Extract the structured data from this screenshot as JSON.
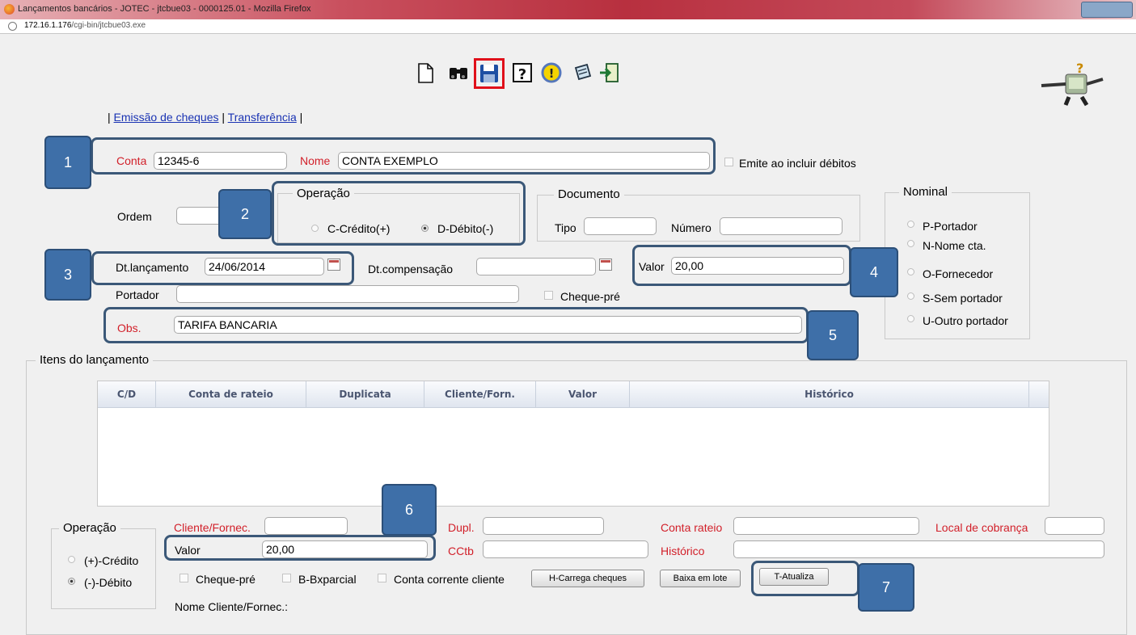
{
  "window": {
    "title": "Lançamentos bancários - JOTEC - jtcbue03 - 0000125.01 - Mozilla Firefox"
  },
  "url": {
    "host": "172.16.1.176",
    "path": "/cgi-bin/jtcbue03.exe"
  },
  "toolbar": {
    "icons": [
      "new-document-icon",
      "binoculars-search-icon",
      "save-floppy-icon",
      "help-question-icon",
      "warning-icon",
      "edit-note-icon",
      "exit-door-icon"
    ]
  },
  "links": {
    "cheques": "Emissão de cheques",
    "transfer": "Transferência",
    "sep": "|"
  },
  "conta": {
    "label": "Conta",
    "value": "12345-6"
  },
  "nome": {
    "label": "Nome",
    "value": "CONTA EXEMPLO"
  },
  "emite": {
    "label": "Emite ao incluir débitos"
  },
  "ordem": {
    "label": "Ordem",
    "value": ""
  },
  "operacao": {
    "title": "Operação",
    "credito": "C-Crédito(+)",
    "debito": "D-Débito(-)",
    "selected": "D"
  },
  "documento": {
    "title": "Documento",
    "tipo_label": "Tipo",
    "numero_label": "Número"
  },
  "nominal": {
    "title": "Nominal",
    "options": [
      "P-Portador",
      "N-Nome cta.",
      "O-Fornecedor",
      "S-Sem portador",
      "U-Outro portador"
    ]
  },
  "dt_lancamento": {
    "label": "Dt.lançamento",
    "value": "24/06/2014"
  },
  "dt_compensacao": {
    "label": "Dt.compensação",
    "value": ""
  },
  "valor": {
    "label": "Valor",
    "value": "20,00"
  },
  "portador": {
    "label": "Portador",
    "value": ""
  },
  "cheque_pre": {
    "label": "Cheque-pré"
  },
  "obs": {
    "label": "Obs.",
    "value": "TARIFA BANCARIA"
  },
  "itens": {
    "title": "Itens do lançamento",
    "columns": [
      "C/D",
      "Conta de rateio",
      "Duplicata",
      "Cliente/Forn.",
      "Valor",
      "Histórico"
    ]
  },
  "itens_form": {
    "operacao_title": "Operação",
    "credito": "(+)-Crédito",
    "debito": "(-)-Débito",
    "cliente_label": "Cliente/Fornec.",
    "dupl_label": "Dupl.",
    "conta_rateio_label": "Conta rateio",
    "local_cobranca_label": "Local de cobrança",
    "valor_label": "Valor",
    "valor_value": "20,00",
    "cctb_label": "CCtb",
    "historico_label": "Histórico",
    "cheque_pre": "Cheque-pré",
    "bxparcial": "B-Bxparcial",
    "conta_corrente": "Conta corrente cliente",
    "carrega_cheques": "H-Carrega cheques",
    "baixa_lote": "Baixa em lote",
    "atualiza": "T-Atualiza",
    "nome_cliente_label": "Nome Cliente/Fornec.:"
  },
  "callouts": [
    "1",
    "2",
    "3",
    "4",
    "5",
    "6",
    "7"
  ]
}
